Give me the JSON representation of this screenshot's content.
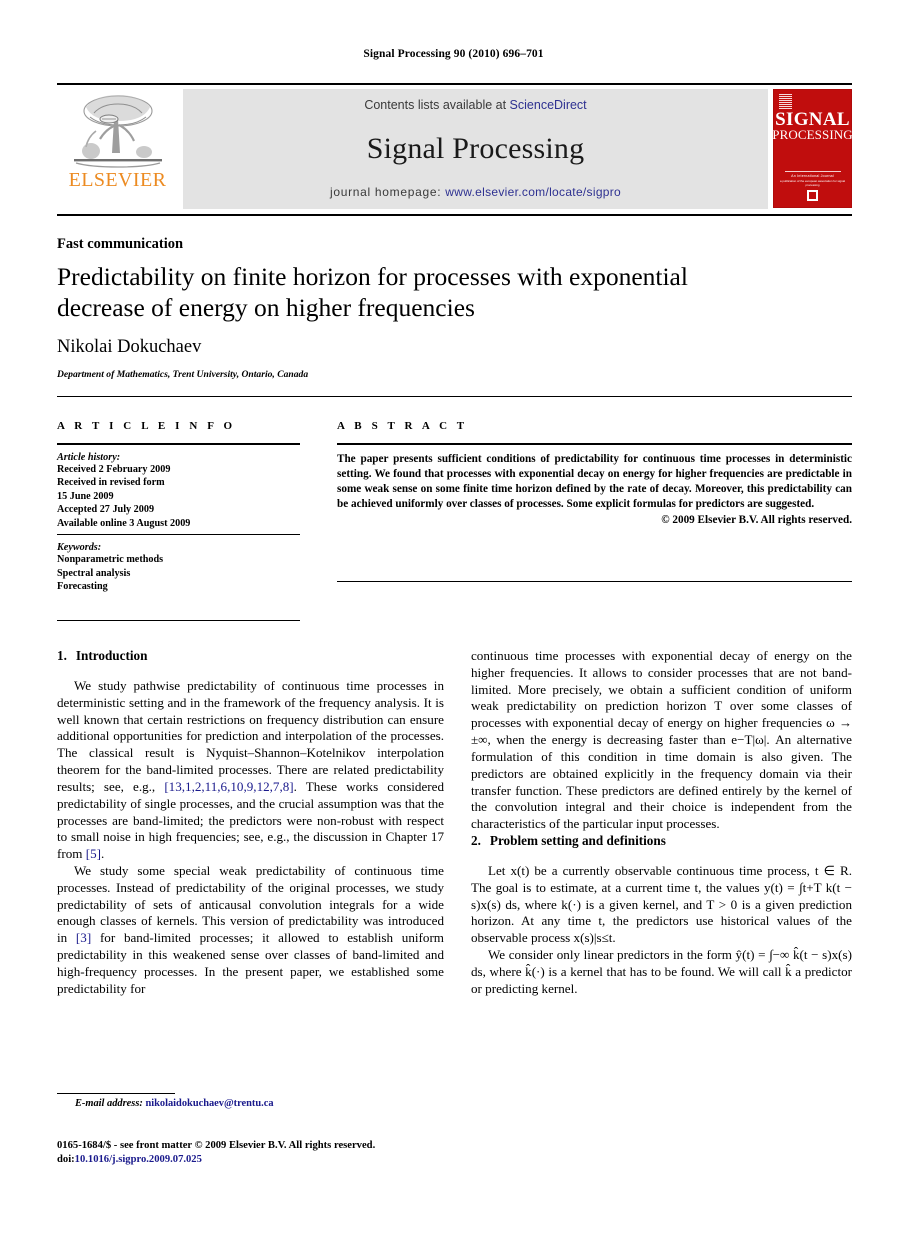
{
  "running_head": "Signal Processing 90 (2010) 696–701",
  "masthead": {
    "publisher_name": "ELSEVIER",
    "contents_prefix": "Contents lists available at ",
    "contents_link": "ScienceDirect",
    "journal_name": "Signal Processing",
    "homepage_prefix": "journal homepage: ",
    "homepage_link": "www.elsevier.com/locate/sigpro",
    "cover": {
      "line1": "SIGNAL",
      "line2": "PROCESSING",
      "tagline": "An International Journal",
      "tagline2": "a publication of the european association for signal processing"
    },
    "colors": {
      "cover_red": "#c00d0d",
      "elsevier_orange": "#ec8b22",
      "link_blue": "#2e3191",
      "band_gray": "#e3e3e3"
    }
  },
  "article": {
    "type": "Fast communication",
    "title": "Predictability on finite horizon for processes with exponential decrease of energy on higher frequencies",
    "author": "Nikolai Dokuchaev",
    "affiliation": "Department of Mathematics, Trent University, Ontario, Canada"
  },
  "info": {
    "heading": "A R T I C L E   I N F O",
    "history_label": "Article history:",
    "history": [
      "Received 2 February 2009",
      "Received in revised form",
      "15 June 2009",
      "Accepted 27 July 2009",
      "Available online 3 August 2009"
    ],
    "keywords_label": "Keywords:",
    "keywords": [
      "Nonparametric methods",
      "Spectral analysis",
      "Forecasting"
    ]
  },
  "abstract": {
    "heading": "A B S T R A C T",
    "text": "The paper presents sufficient conditions of predictability for continuous time processes in deterministic setting. We found that processes with exponential decay on energy for higher frequencies are predictable in some weak sense on some finite time horizon defined by the rate of decay. Moreover, this predictability can be achieved uniformly over classes of processes. Some explicit formulas for predictors are suggested.",
    "copyright": "© 2009 Elsevier B.V. All rights reserved."
  },
  "sections": {
    "intro": {
      "number": "1.",
      "title": "Introduction",
      "para1_a": "We study pathwise predictability of continuous time processes in deterministic setting and in the framework of the frequency analysis. It is well known that certain restrictions on frequency distribution can ensure additional opportunities for prediction and interpolation of the processes. The classical result is Nyquist–Shannon–Kotelnikov interpolation theorem for the band-limited processes. There are related predictability results; see, e.g., ",
      "para1_cite1": "[13,1,2,11,6,10,9,12,7,8]",
      "para1_b": ". These works considered predictability of single processes, and the crucial assumption was that the processes are band-limited; the predictors were non-robust with respect to small noise in high frequencies; see, e.g., the discussion in Chapter 17 from ",
      "para1_cite2": "[5]",
      "para1_c": ".",
      "para2_a": "We study some special weak predictability of continuous time processes. Instead of predictability of the original processes, we study predictability of sets of anticausal convolution integrals for a wide enough classes of kernels. This version of predictability was introduced in ",
      "para2_cite1": "[3]",
      "para2_b": " for band-limited processes; it allowed to establish uniform predictability in this weakened sense over classes of band-limited and high-frequency processes. In the present paper, we established some predictability for continuous time processes with exponential decay of energy on the higher frequencies. It allows to consider processes that are not band-limited. More precisely, we obtain a sufficient condition of uniform weak predictability on prediction horizon T over some classes of processes with exponential decay of energy on higher frequencies ω → ±∞, when the energy is decreasing faster than e−T|ω|. An alternative formulation of this condition in time domain is also given. The predictors are obtained explicitly in the frequency domain via their transfer function. These predictors are defined entirely by the kernel of the convolution integral and their choice is independent from the characteristics of the particular input processes."
    },
    "problem": {
      "number": "2.",
      "title": "Problem setting and definitions",
      "para1": "Let x(t) be a currently observable continuous time process, t ∈ R. The goal is to estimate, at a current time t, the values y(t) = ∫t+T k(t − s)x(s) ds, where k(·) is a given kernel, and T > 0 is a given prediction horizon. At any time t, the predictors use historical values of the observable process x(s)|s≤t.",
      "para2": "We consider only linear predictors in the form ŷ(t) = ∫−∞ k̂(t − s)x(s) ds, where k̂(·) is a kernel that has to be found. We will call k̂ a predictor or predicting kernel."
    }
  },
  "footnote": {
    "label": "E-mail address:",
    "email": "nikolaidokuchaev@trentu.ca"
  },
  "colophon": {
    "line1": "0165-1684/$ - see front matter © 2009 Elsevier B.V. All rights reserved.",
    "doi_prefix": "doi:",
    "doi": "10.1016/j.sigpro.2009.07.025"
  }
}
